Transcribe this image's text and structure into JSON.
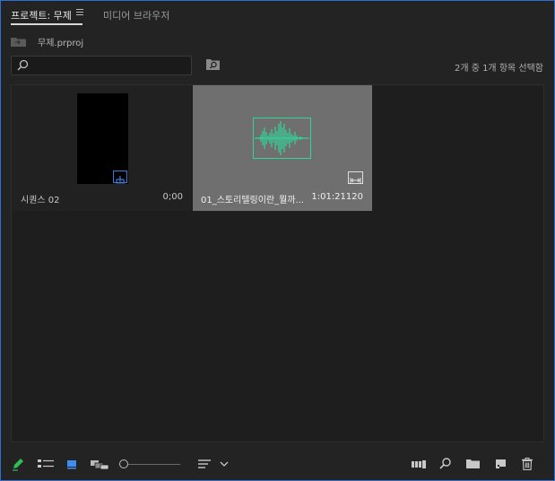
{
  "tabs": {
    "project": "프로젝트: 무제",
    "media_browser": "미디어 브라우저"
  },
  "project_file": "무제.prproj",
  "search": {
    "value": "",
    "placeholder": ""
  },
  "status_text": "2개 중 1개 항목 선택함",
  "items": [
    {
      "name": "시퀀스 02",
      "duration": "0;00",
      "type": "sequence",
      "selected": false
    },
    {
      "name": "01_스토리텔링이란_뭘까...",
      "duration": "1:01:21120",
      "type": "audio",
      "selected": true
    }
  ],
  "icons": {
    "tab_menu": "hamburger-icon",
    "folder": "folder-icon",
    "search": "search-icon",
    "find": "find-icon",
    "pen": "pen-icon",
    "list_view": "list-view-icon",
    "icon_view": "icon-view-icon",
    "freeform_view": "freeform-view-icon",
    "zoom_slider": "zoom-slider",
    "sort": "sort-icon",
    "automate": "automate-to-sequence-icon",
    "find_bottom": "search-icon",
    "new_bin": "new-bin-icon",
    "new_item": "new-item-icon",
    "clear": "trash-icon"
  },
  "colors": {
    "accent_blue": "#2d6fd0",
    "audio_waveform": "#32d49a",
    "pen_green": "#2fbf55",
    "selected_tile": "#6f6f6f"
  }
}
